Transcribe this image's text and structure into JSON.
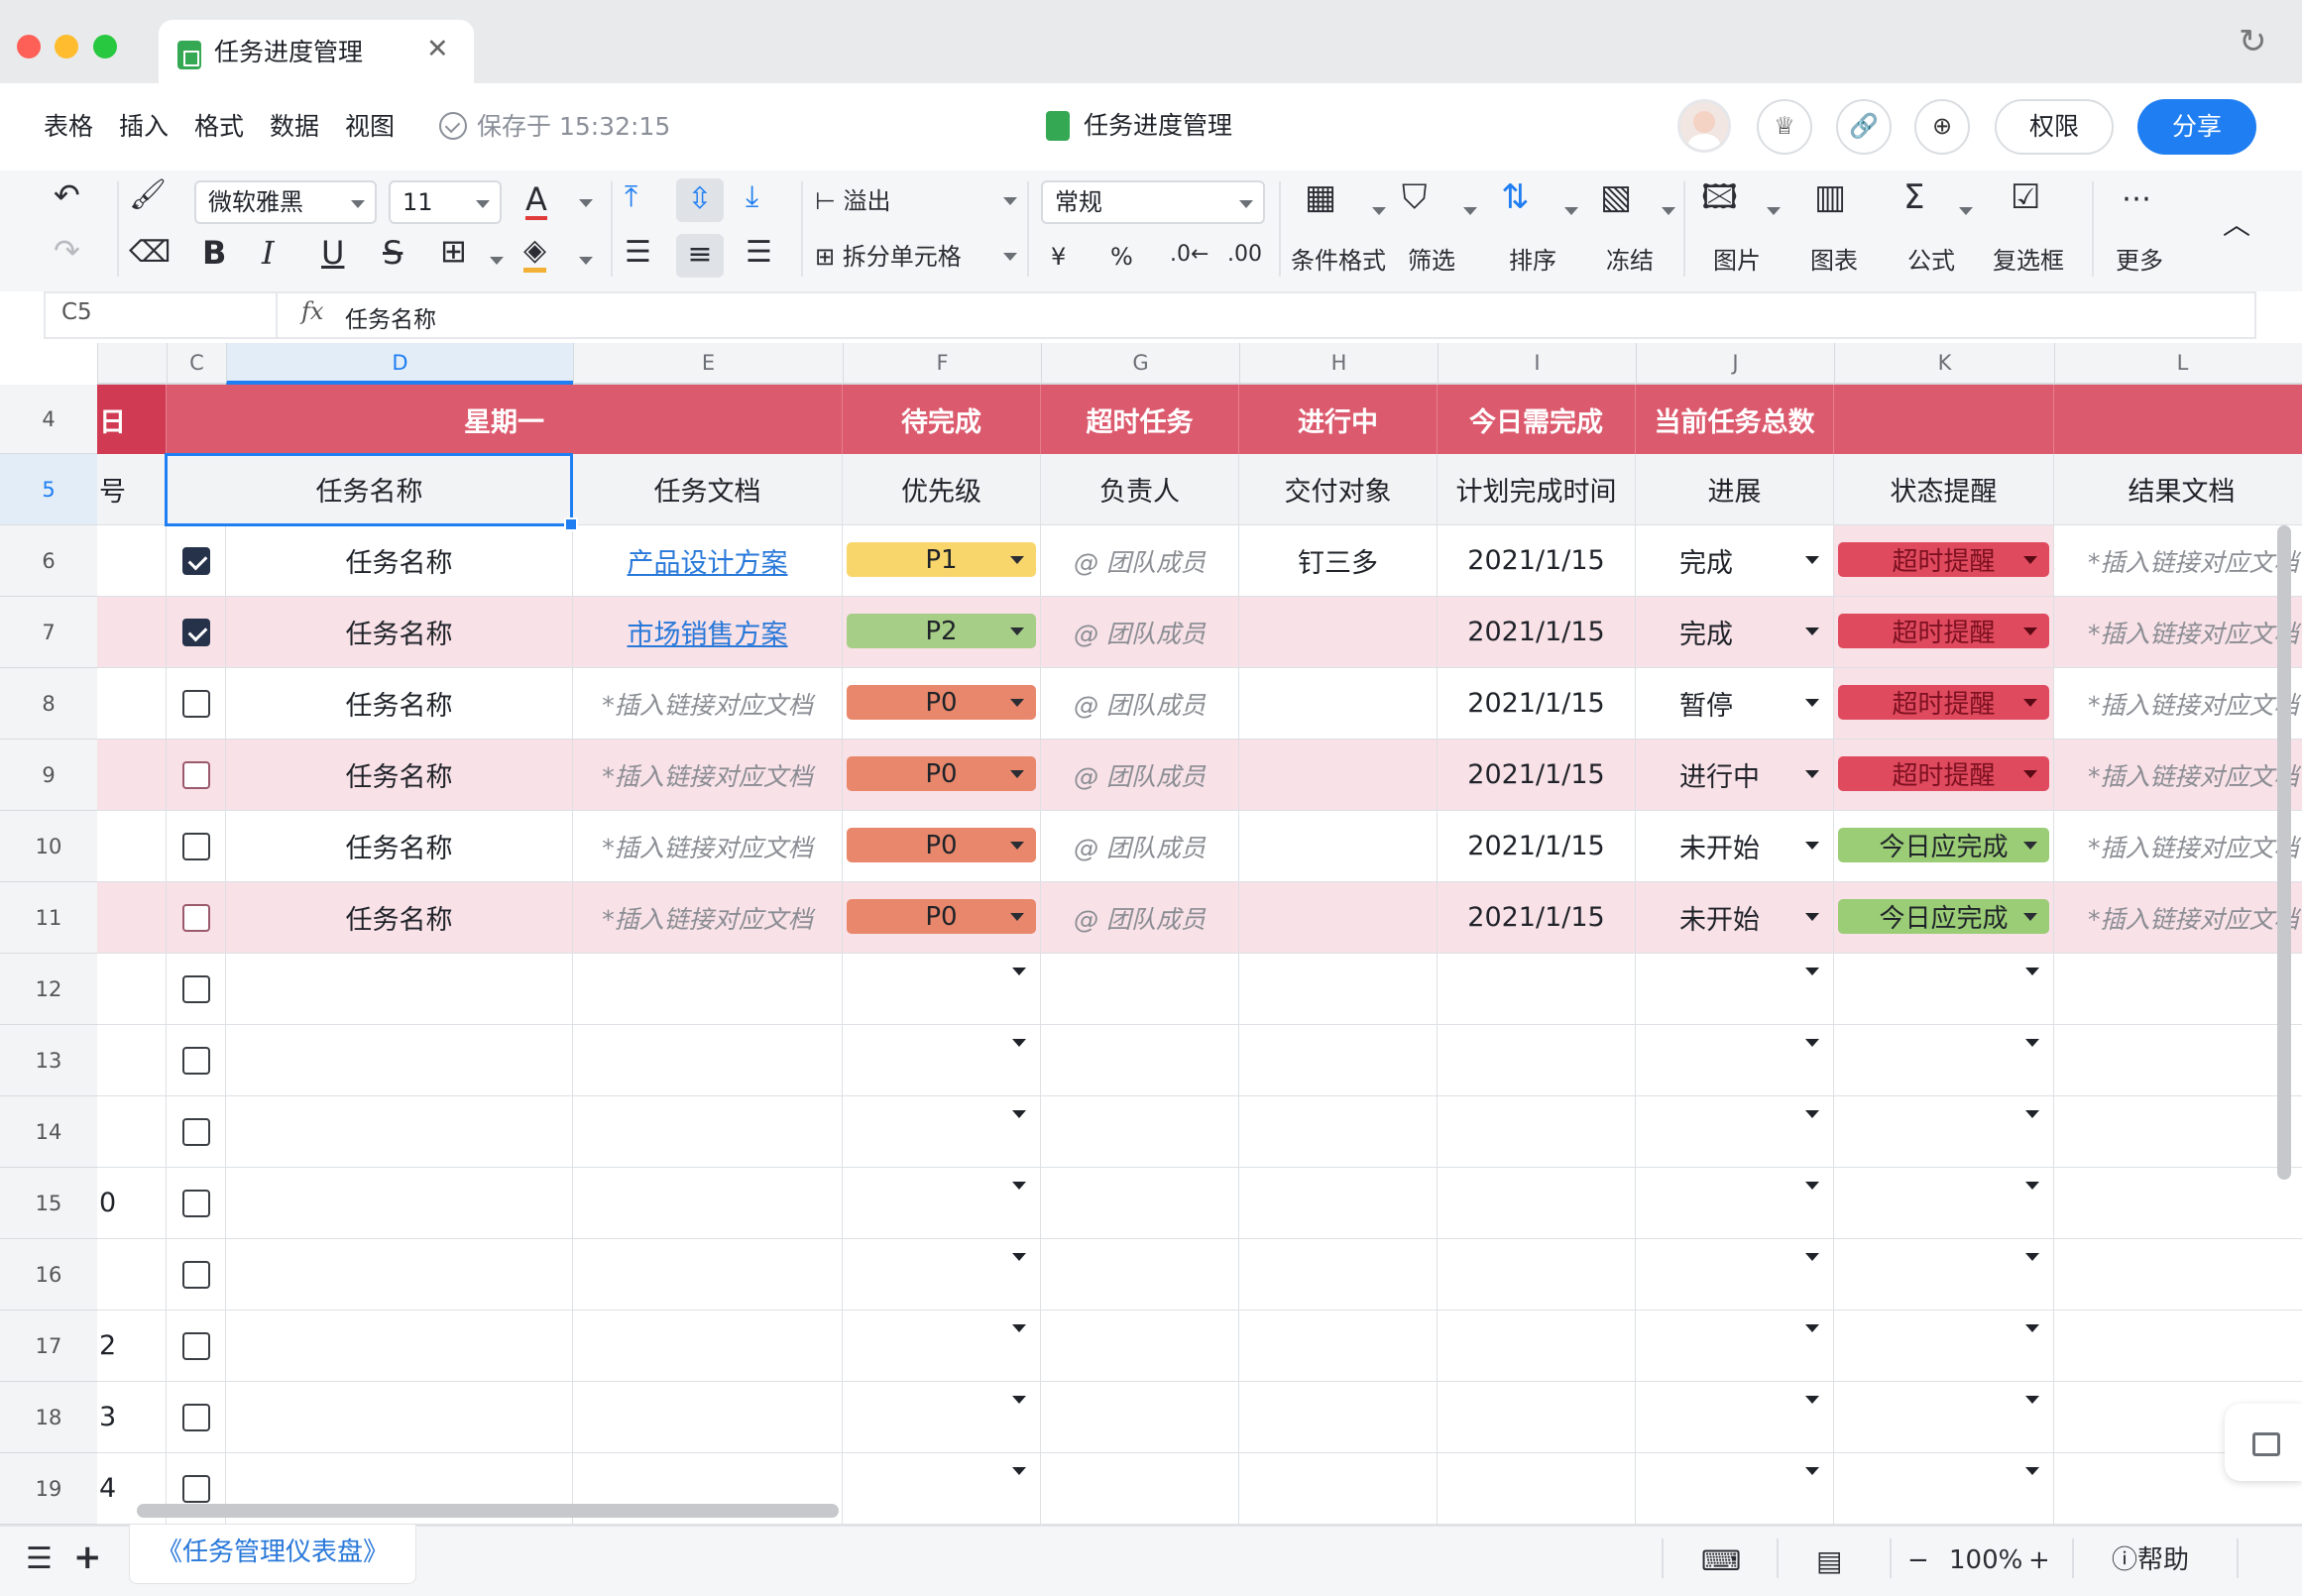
{
  "window": {
    "tab_title": "任务进度管理"
  },
  "menubar": {
    "items": [
      "表格",
      "插入",
      "格式",
      "数据",
      "视图"
    ],
    "saved_text": "保存于 15:32:15",
    "doc_title": "任务进度管理",
    "permissions_label": "权限",
    "share_label": "分享"
  },
  "toolbar": {
    "font_family": "微软雅黑",
    "font_size": "11",
    "overflow_label": "溢出",
    "split_cell_label": "拆分单元格",
    "number_format": "常规",
    "currency_symbol": "¥",
    "percent_symbol": "%",
    "labels": {
      "conditional_format": "条件格式",
      "filter": "筛选",
      "sort": "排序",
      "freeze": "冻结",
      "image": "图片",
      "chart": "图表",
      "formula": "公式",
      "checkbox": "复选框",
      "more": "更多"
    }
  },
  "formula_bar": {
    "cell_ref": "C5",
    "fx": "fx",
    "value": "任务名称"
  },
  "columns": [
    "C",
    "D",
    "E",
    "F",
    "G",
    "H",
    "I",
    "J",
    "K",
    "L"
  ],
  "rows": [
    "4",
    "5",
    "6",
    "7",
    "8",
    "9",
    "10",
    "11",
    "12",
    "13",
    "14",
    "15",
    "16",
    "17",
    "18",
    "19"
  ],
  "left_frozen": {
    "row4": "日",
    "row5": "号",
    "row15": "0",
    "row17": "2",
    "row18": "3",
    "row19": "4"
  },
  "summary_row": {
    "monday": "星期一",
    "pending": "待完成",
    "overdue": "超时任务",
    "in_progress": "进行中",
    "due_today": "今日需完成",
    "total": "当前任务总数"
  },
  "headers": {
    "task_name": "任务名称",
    "task_doc": "任务文档",
    "priority": "优先级",
    "owner": "负责人",
    "deliver_to": "交付对象",
    "planned_date": "计划完成时间",
    "progress": "进展",
    "status_alert": "状态提醒",
    "result_doc": "结果文档"
  },
  "tasks": [
    {
      "done": true,
      "name": "任务名称",
      "doc": "产品设计方案",
      "doc_is_link": true,
      "priority": "P1",
      "owner": "@ 团队成员",
      "deliver": "钉三多",
      "date": "2021/1/15",
      "progress": "完成",
      "status": "超时提醒",
      "result": "*插入链接对应文档"
    },
    {
      "done": true,
      "name": "任务名称",
      "doc": "市场销售方案",
      "doc_is_link": true,
      "priority": "P2",
      "owner": "@ 团队成员",
      "deliver": "",
      "date": "2021/1/15",
      "progress": "完成",
      "status": "超时提醒",
      "result": "*插入链接对应文档"
    },
    {
      "done": false,
      "name": "任务名称",
      "doc": "*插入链接对应文档",
      "doc_is_link": false,
      "priority": "P0",
      "owner": "@ 团队成员",
      "deliver": "",
      "date": "2021/1/15",
      "progress": "暂停",
      "status": "超时提醒",
      "result": "*插入链接对应文档"
    },
    {
      "done": false,
      "name": "任务名称",
      "doc": "*插入链接对应文档",
      "doc_is_link": false,
      "priority": "P0",
      "owner": "@ 团队成员",
      "deliver": "",
      "date": "2021/1/15",
      "progress": "进行中",
      "status": "超时提醒",
      "result": "*插入链接对应文档"
    },
    {
      "done": false,
      "name": "任务名称",
      "doc": "*插入链接对应文档",
      "doc_is_link": false,
      "priority": "P0",
      "owner": "@ 团队成员",
      "deliver": "",
      "date": "2021/1/15",
      "progress": "未开始",
      "status": "今日应完成",
      "result": "*插入链接对应文档"
    },
    {
      "done": false,
      "name": "任务名称",
      "doc": "*插入链接对应文档",
      "doc_is_link": false,
      "priority": "P0",
      "owner": "@ 团队成员",
      "deliver": "",
      "date": "2021/1/15",
      "progress": "未开始",
      "status": "今日应完成",
      "result": "*插入链接对应文档"
    }
  ],
  "colors": {
    "header_red": "#dc5a6e",
    "pink_row": "#f8e1e7",
    "priority_P0": "#e8876b",
    "priority_P1": "#f8d66c",
    "priority_P2": "#a7ce86",
    "status_overdue": "#e04a5e",
    "status_today": "#9bcc76",
    "accent": "#1f7ef2"
  },
  "statusbar": {
    "sheet_tab": "《任务管理仪表盘》",
    "zoom": "100%",
    "help": "帮助"
  }
}
